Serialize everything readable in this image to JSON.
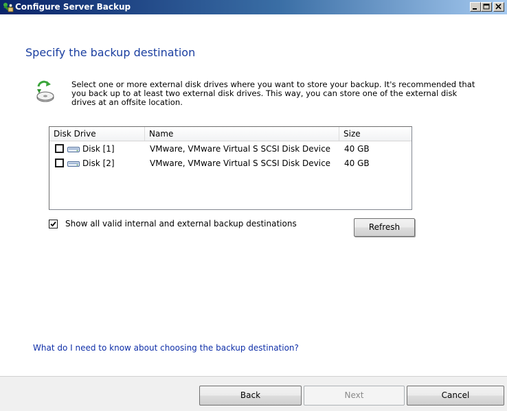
{
  "window": {
    "title": "Configure Server Backup",
    "controls": {
      "minimize": "minimize",
      "maximize": "maximize",
      "close": "close"
    }
  },
  "page": {
    "heading": "Specify the backup destination",
    "description": "Select one or more external disk drives where you want to store your backup. It's recommended that you back up to at least two external disk drives. This way, you can store one of the external disk drives at an offsite location."
  },
  "disk_list": {
    "columns": {
      "drive": "Disk Drive",
      "name": "Name",
      "size": "Size"
    },
    "rows": [
      {
        "drive": "Disk [1]",
        "name": "VMware, VMware Virtual S SCSI Disk Device",
        "size": "40 GB",
        "checked": false
      },
      {
        "drive": "Disk [2]",
        "name": "VMware, VMware Virtual S SCSI Disk Device",
        "size": "40 GB",
        "checked": false
      }
    ]
  },
  "show_all": {
    "label": "Show all valid internal and external backup destinations",
    "checked": true
  },
  "refresh_label": "Refresh",
  "help_link": "What do I need to know about choosing the backup destination?",
  "buttons": {
    "back": "Back",
    "next": "Next",
    "cancel": "Cancel",
    "next_enabled": false
  },
  "colors": {
    "heading": "#1a3ea0",
    "link": "#0f2fa8",
    "titlebar_start": "#0a246a",
    "titlebar_end": "#a6caf0"
  },
  "icons": {
    "title": "server-backup-icon",
    "wizard": "backup-disk-icon",
    "disk": "hard-disk-icon"
  }
}
